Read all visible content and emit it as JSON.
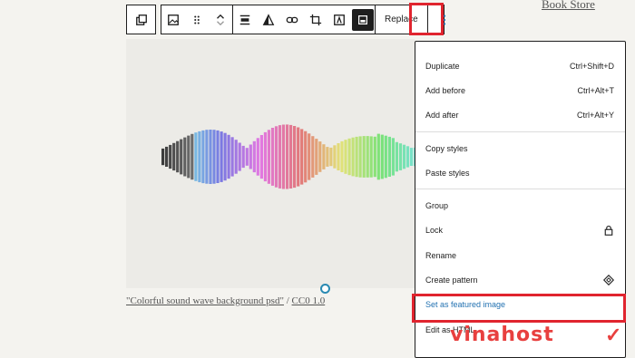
{
  "page": {
    "top_link": "Book Store"
  },
  "toolbar": {
    "replace_label": "Replace",
    "icons": [
      "parent-block-icon",
      "image-icon",
      "drag-handle-icon",
      "move-up-down-icon",
      "align-icon",
      "duotone-icon",
      "link-icon",
      "crop-icon",
      "text-overlay-icon",
      "expand-icon",
      "more-options-icon"
    ]
  },
  "image": {
    "caption_link": "\"Colorful sound wave background psd\"",
    "caption_sep": "/",
    "caption_license": "CC0 1.0"
  },
  "menu": {
    "section1": [
      {
        "label": "Duplicate",
        "shortcut": "Ctrl+Shift+D"
      },
      {
        "label": "Add before",
        "shortcut": "Ctrl+Alt+T"
      },
      {
        "label": "Add after",
        "shortcut": "Ctrl+Alt+Y"
      }
    ],
    "section2": [
      {
        "label": "Copy styles"
      },
      {
        "label": "Paste styles"
      }
    ],
    "section3": [
      {
        "label": "Group"
      },
      {
        "label": "Lock",
        "icon": "lock-icon"
      },
      {
        "label": "Rename"
      },
      {
        "label": "Create pattern",
        "icon": "pattern-icon"
      },
      {
        "label": "Set as featured image"
      },
      {
        "label": "Edit as HTML"
      }
    ]
  },
  "watermark": {
    "text": "vinahost",
    "check": "✓"
  },
  "colors": {
    "highlight": "#e0242e",
    "accent_blue": "#2271b1",
    "handle": "#2a8ab2"
  }
}
